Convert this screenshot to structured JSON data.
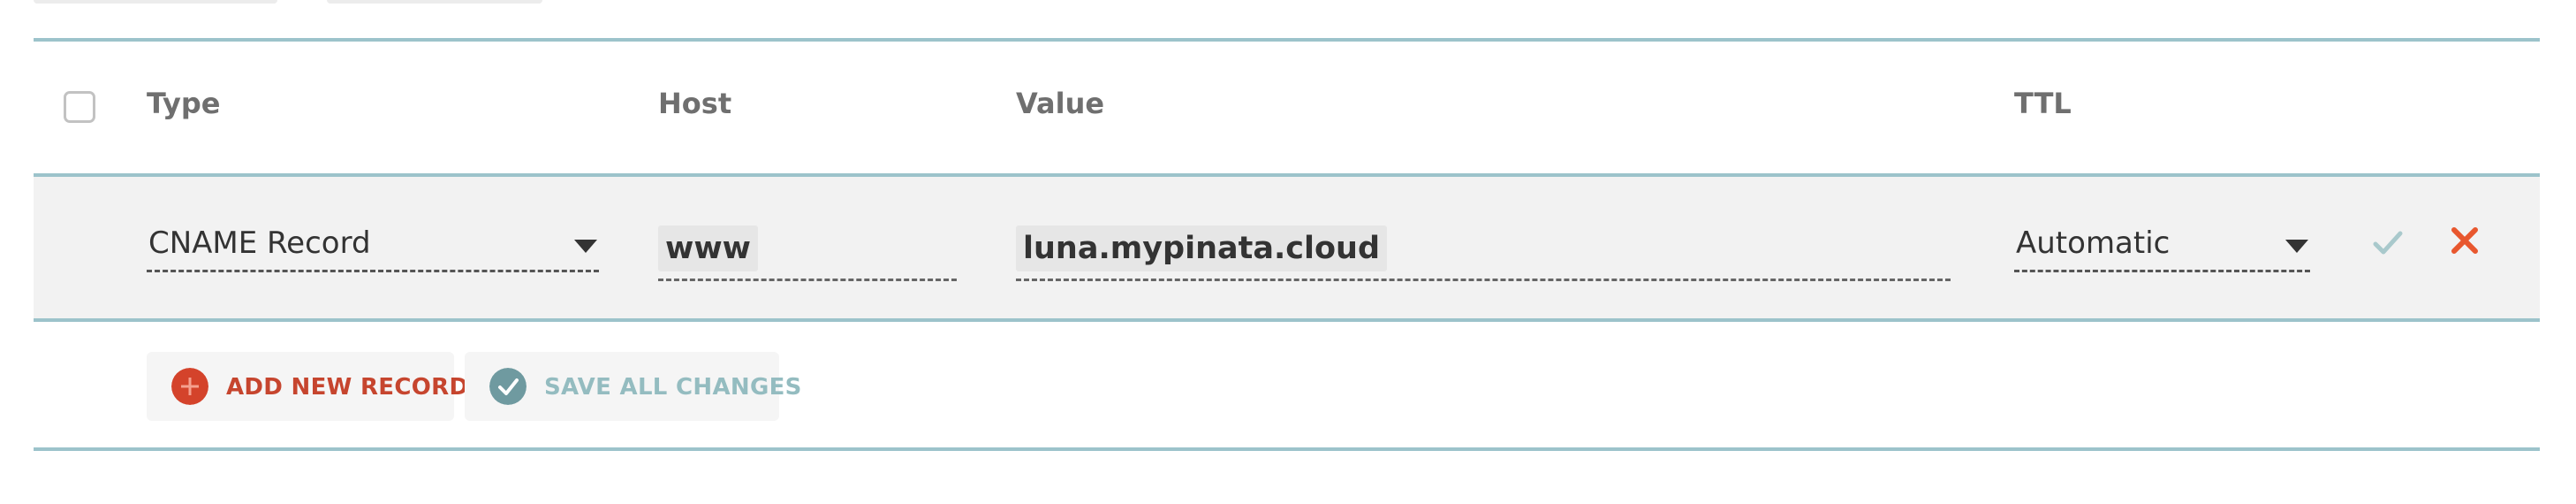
{
  "table": {
    "columns": {
      "type": "Type",
      "host": "Host",
      "value": "Value",
      "ttl": "TTL"
    }
  },
  "record": {
    "type": "CNAME Record",
    "host": "www",
    "value": "luna.mypinata.cloud",
    "ttl": "Automatic"
  },
  "actions": {
    "add_label": "ADD NEW RECORD",
    "save_label": "SAVE ALL CHANGES"
  },
  "colors": {
    "divider": "#9cc3cb",
    "add_accent": "#d4432b",
    "save_accent": "#6f9aa0",
    "delete": "#e8572e",
    "confirm": "#a9c9cc"
  }
}
